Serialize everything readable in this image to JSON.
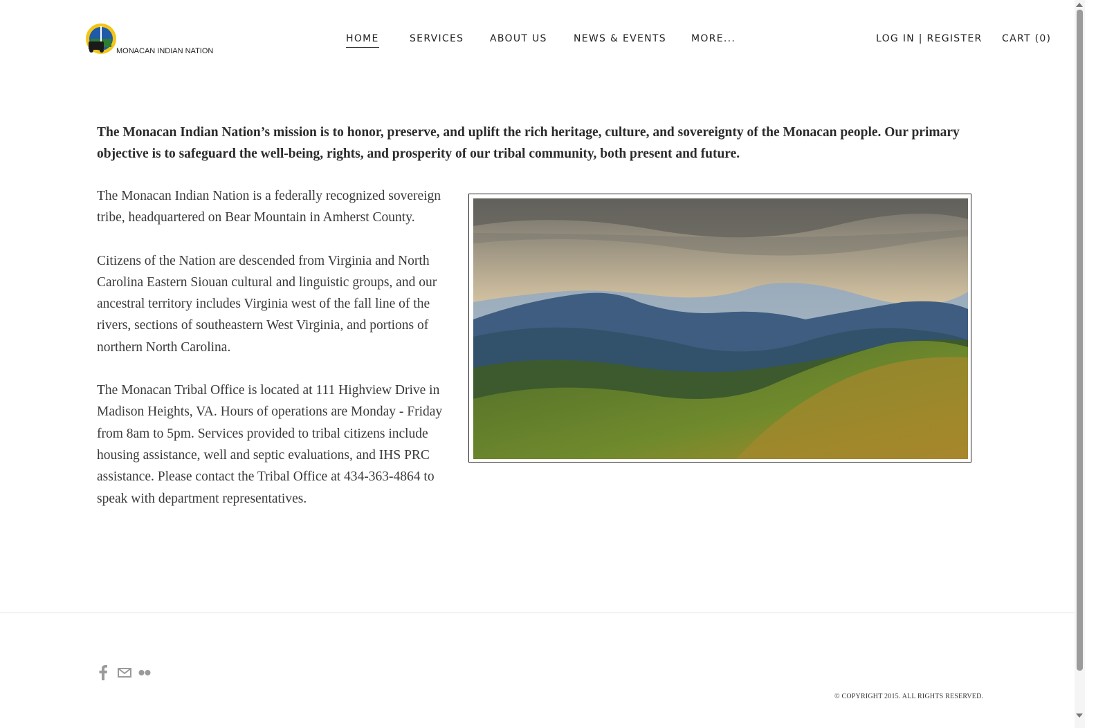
{
  "header": {
    "logo_text": "MONACAN INDIAN NATION",
    "nav": {
      "home": "HOME",
      "services": "SERVICES",
      "about": "ABOUT US",
      "news": "NEWS & EVENTS",
      "more": "MORE...",
      "login": "LOG IN | REGISTER",
      "cart": "CART (0)"
    }
  },
  "main": {
    "mission": "The Monacan Indian Nation’s mission is to honor, preserve, and uplift the rich heritage, culture, and sovereignty of the Monacan people. Our primary objective is to safeguard the well-being, rights, and prosperity of our tribal community, both present and future.",
    "paragraphs": [
      "The Monacan Indian Nation is a federally recognized sovereign tribe, headquartered on Bear Mountain in Amherst County.",
      "Citizens of the Nation are descended from Virginia and North Carolina Eastern Siouan cultural and linguistic groups, and our ancestral territory includes Virginia west of the fall line of the rivers, sections of southeastern West Virginia, and portions of northern North Carolina.",
      "The Monacan Tribal Office is located at 111 Highview Drive in Madison Heights, VA. Hours of operations are Monday - Friday from 8am to 5pm. Services provided to tribal citizens include housing assistance, well and septic evaluations, and IHS PRC assistance. Please contact the Tribal Office at 434-363-4864 to speak with department representatives."
    ]
  },
  "footer": {
    "social_icons": [
      "facebook-icon",
      "mail-icon",
      "flickr-icon"
    ],
    "copyright": "© COPYRIGHT 2015. ALL RIGHTS RESERVED."
  },
  "colors": {
    "text": "#2b2b2b",
    "footer_rule": "#e2e2e2",
    "icon_gray": "#9a9a9a"
  }
}
